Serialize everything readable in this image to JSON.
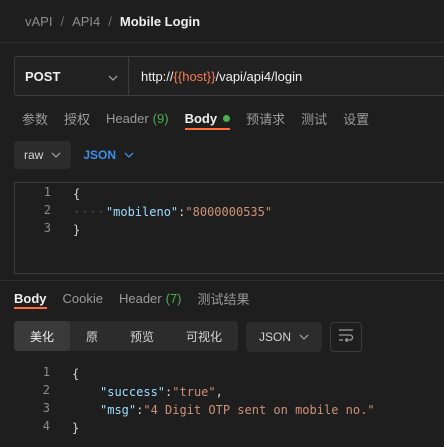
{
  "breadcrumb": {
    "items": [
      "vAPI",
      "API4"
    ],
    "separator": "/",
    "current": "Mobile Login"
  },
  "request": {
    "method": "POST",
    "url_prefix": "http://",
    "url_var": "{{host}}",
    "url_suffix": "/vapi/api4/login"
  },
  "request_tabs": [
    {
      "label": "参数"
    },
    {
      "label": "授权"
    },
    {
      "label": "Header",
      "count": "(9)"
    },
    {
      "label": "Body"
    },
    {
      "label": "预请求"
    },
    {
      "label": "测试"
    },
    {
      "label": "设置"
    }
  ],
  "body_type": {
    "mode": "raw",
    "language": "JSON"
  },
  "request_body": {
    "line_numbers": [
      "1",
      "2",
      "3"
    ],
    "open_brace": "{",
    "indent": "····",
    "key": "\"mobileno\"",
    "colon": ":",
    "value": "\"8000000535\"",
    "close_brace": "}"
  },
  "response_tabs": [
    {
      "label": "Body"
    },
    {
      "label": "Cookie"
    },
    {
      "label": "Header",
      "count": "(7)"
    },
    {
      "label": "测试结果"
    }
  ],
  "response_view": {
    "modes": [
      "美化",
      "原",
      "预览",
      "可视化"
    ],
    "active_mode": "美化",
    "language": "JSON"
  },
  "response_body": {
    "line_numbers": [
      "1",
      "2",
      "3",
      "4"
    ],
    "open_brace": "{",
    "lines": [
      {
        "key": "\"success\"",
        "colon": ": ",
        "value": "\"true\"",
        "trail": ","
      },
      {
        "key": "\"msg\"",
        "colon": ": ",
        "value": "\"4 Digit OTP sent on mobile no.\"",
        "trail": ""
      }
    ],
    "close_brace": "}"
  },
  "colors": {
    "accent": "#ff6c37",
    "status_green": "#4caf50",
    "link_blue": "#3d8ee8",
    "variable_orange": "#f47c55"
  }
}
